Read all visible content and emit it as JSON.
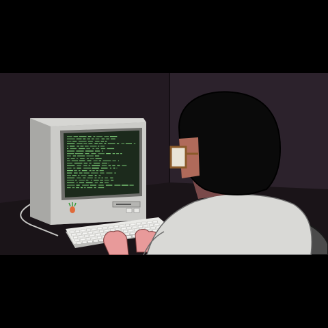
{
  "scene": {
    "description_hidden": false,
    "colors": {
      "letterbox": "#000000",
      "wall": "#231a22",
      "wall_light": "#2e2430",
      "desk": "#181216",
      "monitor_body": "#c9c9c6",
      "monitor_shadow": "#8e8e8b",
      "screen_bg": "#1c2a1c",
      "terminal_text": "#7fd17a",
      "keyboard": "#e6e6e3",
      "hair": "#0a0a0a",
      "skin": "#e89a9a",
      "coat": "#d9d9d6",
      "chair": "#4a4a4a"
    },
    "icons": {
      "logo": "radish-logo-icon",
      "floppy": "floppy-drive-icon"
    },
    "terminal_line_count": 22
  }
}
